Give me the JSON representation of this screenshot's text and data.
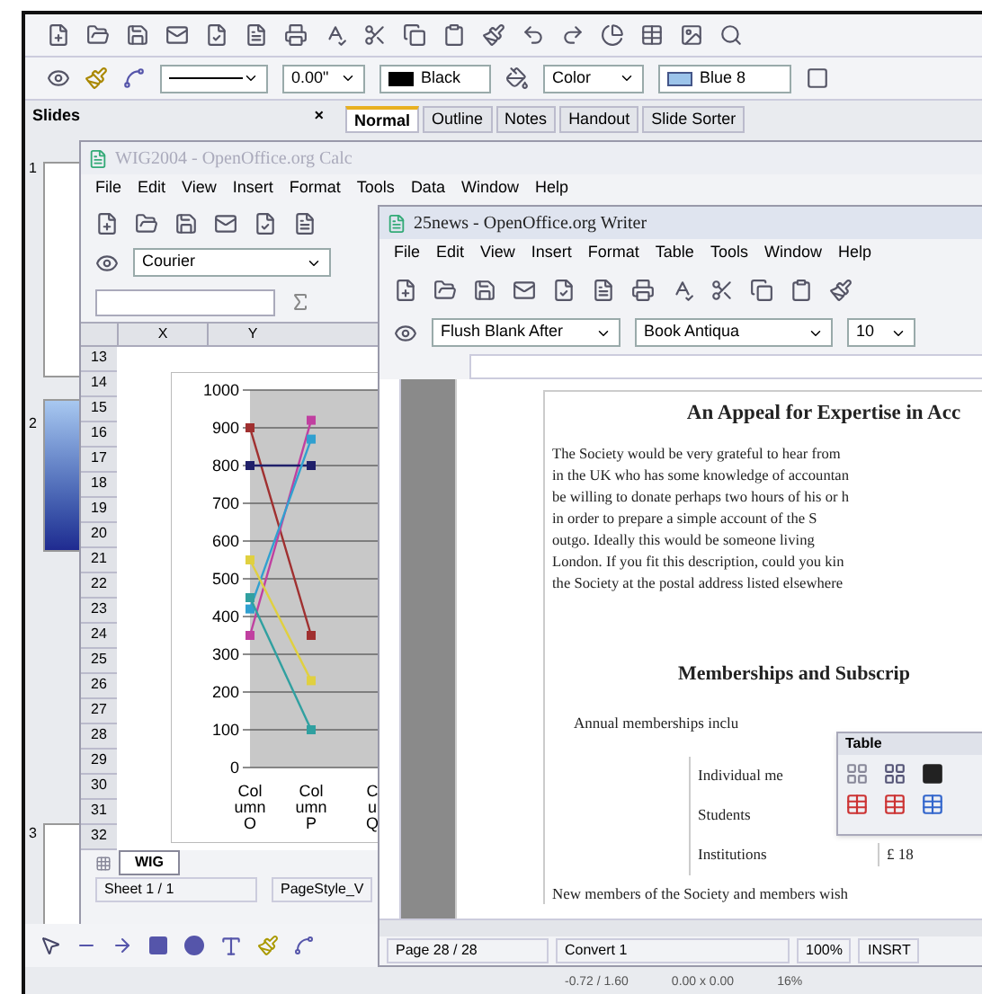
{
  "impress": {
    "line_width": "0.00\"",
    "line_color": "Black",
    "area_style": "Color",
    "area_fill": "Blue 8",
    "slides_panel": {
      "title": "Slides",
      "close": "×",
      "slide_numbers": [
        "1",
        "2",
        "3"
      ]
    },
    "view_tabs": [
      {
        "label": "Normal",
        "selected": true
      },
      {
        "label": "Outline",
        "selected": false
      },
      {
        "label": "Notes",
        "selected": false
      },
      {
        "label": "Handout",
        "selected": false
      },
      {
        "label": "Slide Sorter",
        "selected": false
      }
    ],
    "status_bar": [
      "-0.72 / 1.60",
      "0.00 x 0.00",
      "16%"
    ]
  },
  "calc": {
    "title": "WIG2004 - OpenOffice.org Calc",
    "active": false,
    "menu": [
      "File",
      "Edit",
      "View",
      "Insert",
      "Format",
      "Tools",
      "Data",
      "Window",
      "Help"
    ],
    "font_name": "Courier",
    "columns": [
      "X",
      "Y"
    ],
    "rows": [
      "13",
      "14",
      "15",
      "16",
      "17",
      "18",
      "19",
      "20",
      "21",
      "22",
      "23",
      "24",
      "25",
      "26",
      "27",
      "28",
      "29",
      "30",
      "31",
      "32"
    ],
    "sheet_tab": "WIG",
    "status_bar": [
      "Sheet 1 / 1",
      "PageStyle_V"
    ],
    "chart_data": {
      "type": "line",
      "grid": true,
      "categories": [
        "Col umn O",
        "Col umn P",
        "C u Q"
      ],
      "ylim": [
        0,
        1000
      ],
      "yticks": [
        0,
        100,
        200,
        300,
        400,
        500,
        600,
        700,
        800,
        900,
        1000
      ],
      "series": [
        {
          "color": "#a03030",
          "marker": "square",
          "values": [
            900,
            350,
            null
          ]
        },
        {
          "color": "#c040a0",
          "marker": "square",
          "values": [
            350,
            920,
            null
          ]
        },
        {
          "color": "#20206a",
          "marker": "square",
          "values": [
            800,
            800,
            null
          ]
        },
        {
          "color": "#30a0d0",
          "marker": "square",
          "values": [
            420,
            870,
            null
          ]
        },
        {
          "color": "#e0d040",
          "marker": "square",
          "values": [
            550,
            230,
            null
          ]
        },
        {
          "color": "#30a0a0",
          "marker": "square",
          "values": [
            450,
            100,
            null
          ]
        }
      ]
    }
  },
  "writer": {
    "title": "25news - OpenOffice.org Writer",
    "active": true,
    "menu": [
      "File",
      "Edit",
      "View",
      "Insert",
      "Format",
      "Table",
      "Tools",
      "Window",
      "Help"
    ],
    "paragraph_style": "Flush Blank After",
    "font_name": "Book Antiqua",
    "font_size": "10",
    "heading": "An Appeal for Expertise in Acc",
    "body_lines": [
      "The Society would be very grateful to hear from",
      "in the UK who has some knowledge of accountan",
      "be willing to donate perhaps two hours of his or h",
      "in order to prepare a simple account of the S",
      "outgo. Ideally this would be someone living",
      "London. If you fit this description, could you kin",
      "the Society at the postal address listed elsewhere"
    ],
    "subheading": "Memberships and Subscrip",
    "intro": "Annual memberships inclu",
    "table": [
      [
        "Individual me"
      ],
      [
        "Students"
      ],
      [
        "Institutions",
        "£ 18"
      ]
    ],
    "last_line": "New members of the Society and members wish",
    "table_toolbar": {
      "title": "Table"
    },
    "status_bar": [
      "Page 28 / 28",
      "Convert 1",
      "100%",
      "INSRT"
    ]
  }
}
